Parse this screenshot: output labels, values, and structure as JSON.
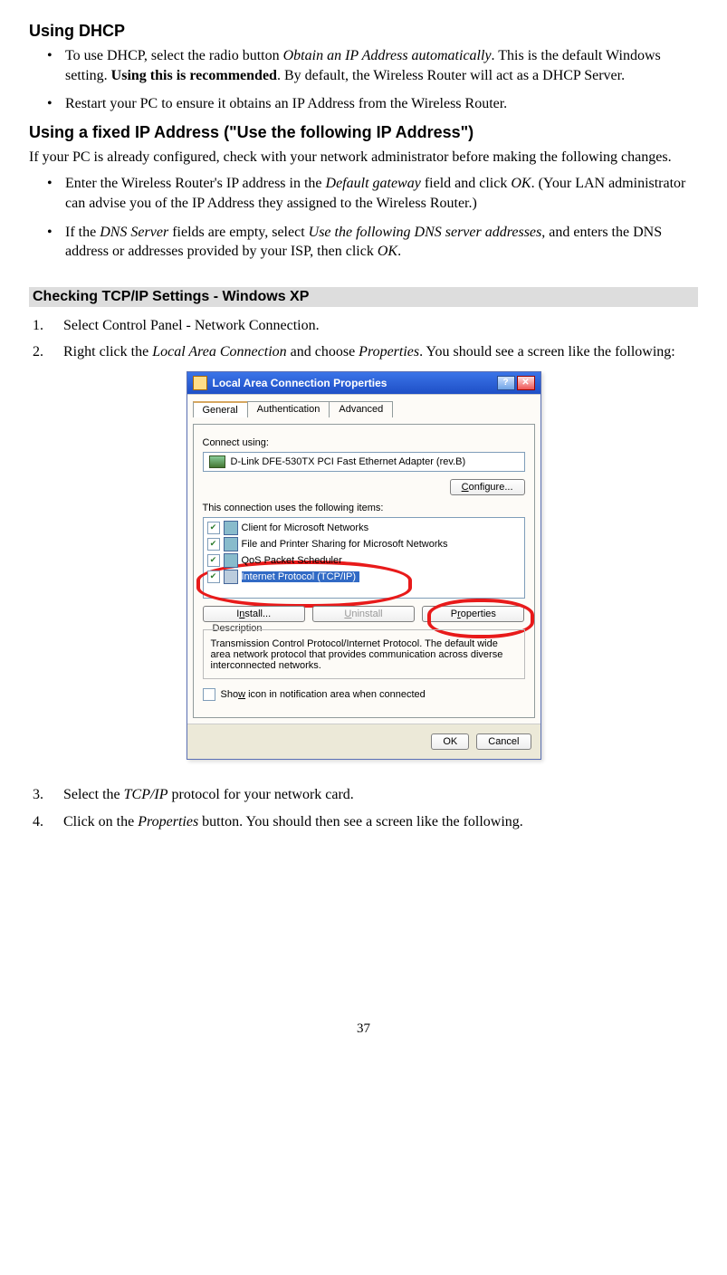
{
  "headings": {
    "using_dhcp": "Using DHCP",
    "using_fixed": "Using a fixed IP Address (\"Use the following IP Address\")",
    "checking": "Checking TCP/IP Settings - Windows XP"
  },
  "dhcp_bullets": {
    "b1_pre": "To use DHCP, select the radio button ",
    "b1_em": "Obtain an IP Address automatically",
    "b1_mid": ". This is the default Windows setting. ",
    "b1_bold": "Using this is recommended",
    "b1_post": ". By default, the Wireless Router will act as a DHCP Server.",
    "b2": "Restart your PC to ensure it obtains an IP Address from the Wireless Router."
  },
  "fixed_intro": "If your PC is already configured, check with your network administrator before making the following changes.",
  "fixed_bullets": {
    "b1_pre": "Enter the Wireless Router's IP address in the ",
    "b1_em1": "Default gateway",
    "b1_mid": " field and click ",
    "b1_em2": "OK",
    "b1_post": ". (Your LAN administrator can advise you of the IP Address they assigned to the Wireless Router.)",
    "b2_pre": "If the ",
    "b2_em1": "DNS Server",
    "b2_mid1": " fields are empty, select ",
    "b2_em2": "Use the following DNS server addresses",
    "b2_mid2": ", and enters the DNS address or addresses provided by your ISP, then click ",
    "b2_em3": "OK",
    "b2_post": "."
  },
  "steps": {
    "s1": "Select Control Panel - Network Connection.",
    "s2_pre": "Right click the ",
    "s2_em1": "Local Area Connection",
    "s2_mid": " and choose ",
    "s2_em2": "Properties",
    "s2_post": ". You should see a screen like the following:",
    "s3_pre": "Select the ",
    "s3_em": "TCP/IP",
    "s3_post": " protocol for your network card.",
    "s4_pre": "Click on the ",
    "s4_em": "Properties",
    "s4_post": " button. You should then see a screen like the following."
  },
  "dialog": {
    "title": "Local Area Connection Properties",
    "tabs": {
      "general": "General",
      "auth": "Authentication",
      "adv": "Advanced"
    },
    "connect_using": "Connect using:",
    "adapter": "D-Link DFE-530TX PCI Fast Ethernet Adapter (rev.B)",
    "configure": "Configure...",
    "uses_items_label": "This connection uses the following items:",
    "items": {
      "client": "Client for Microsoft Networks",
      "fileprint": "File and Printer Sharing for Microsoft Networks",
      "qos": "QoS Packet Scheduler",
      "tcpip": "Internet Protocol (TCP/IP)"
    },
    "install": "Install...",
    "uninstall": "Uninstall",
    "properties": "Properties",
    "desc_title": "Description",
    "desc_text": "Transmission Control Protocol/Internet Protocol. The default wide area network protocol that provides communication across diverse interconnected networks.",
    "show_icon": "Show icon in notification area when connected",
    "ok": "OK",
    "cancel": "Cancel"
  },
  "page_number": "37"
}
